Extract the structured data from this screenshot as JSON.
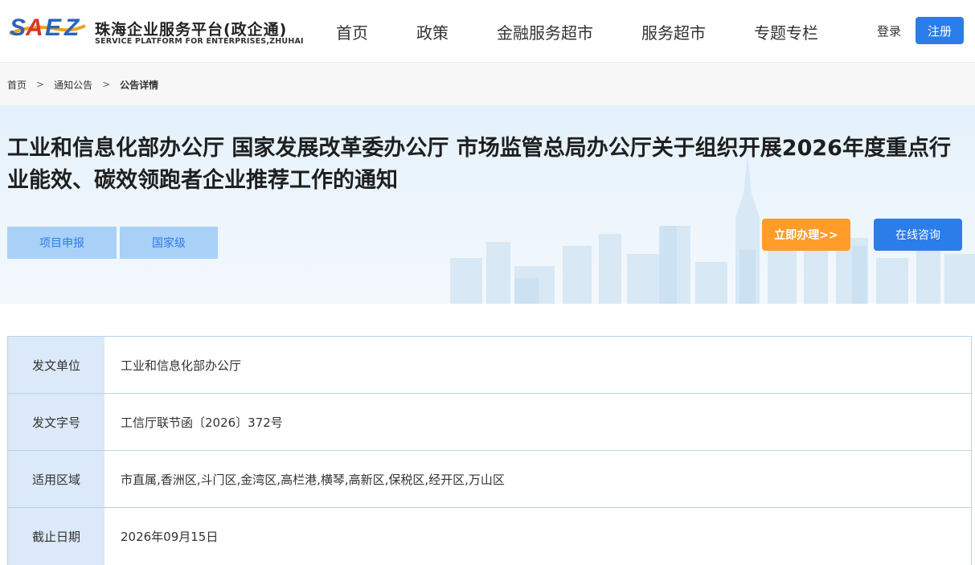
{
  "header": {
    "logo_mark_text": "SAEZ",
    "logo_cn": "珠海企业服务平台(政企通)",
    "logo_en": "SERVICE PLATFORM FOR ENTERPRISES,ZHUHAI",
    "nav": [
      "首页",
      "政策",
      "金融服务超市",
      "服务超市",
      "专题专栏"
    ],
    "login_label": "登录",
    "register_label": "注册"
  },
  "breadcrumb": {
    "items": [
      "首页",
      "通知公告",
      "公告详情"
    ],
    "separator": ">"
  },
  "banner": {
    "title": "工业和信息化部办公厅 国家发展改革委办公厅 市场监管总局办公厅关于组织开展2026年度重点行业能效、碳效领跑者企业推荐工作的通知",
    "tags": [
      "项目申报",
      "国家级"
    ],
    "apply_label": "立即办理>>",
    "consult_label": "在线咨询"
  },
  "info": {
    "rows": [
      {
        "label": "发文单位",
        "value": "工业和信息化部办公厅"
      },
      {
        "label": "发文字号",
        "value": "工信厅联节函〔2026〕372号"
      },
      {
        "label": "适用区域",
        "value": "市直属,香洲区,斗门区,金湾区,高栏港,横琴,高新区,保税区,经开区,万山区"
      },
      {
        "label": "截止日期",
        "value": "2026年09月15日"
      }
    ]
  },
  "colors": {
    "primary": "#2b7de9",
    "orange": "#ff9c2a",
    "tag_bg": "#a9d1f7",
    "label_bg": "#dbe9f8",
    "border": "#b7d3ef"
  }
}
